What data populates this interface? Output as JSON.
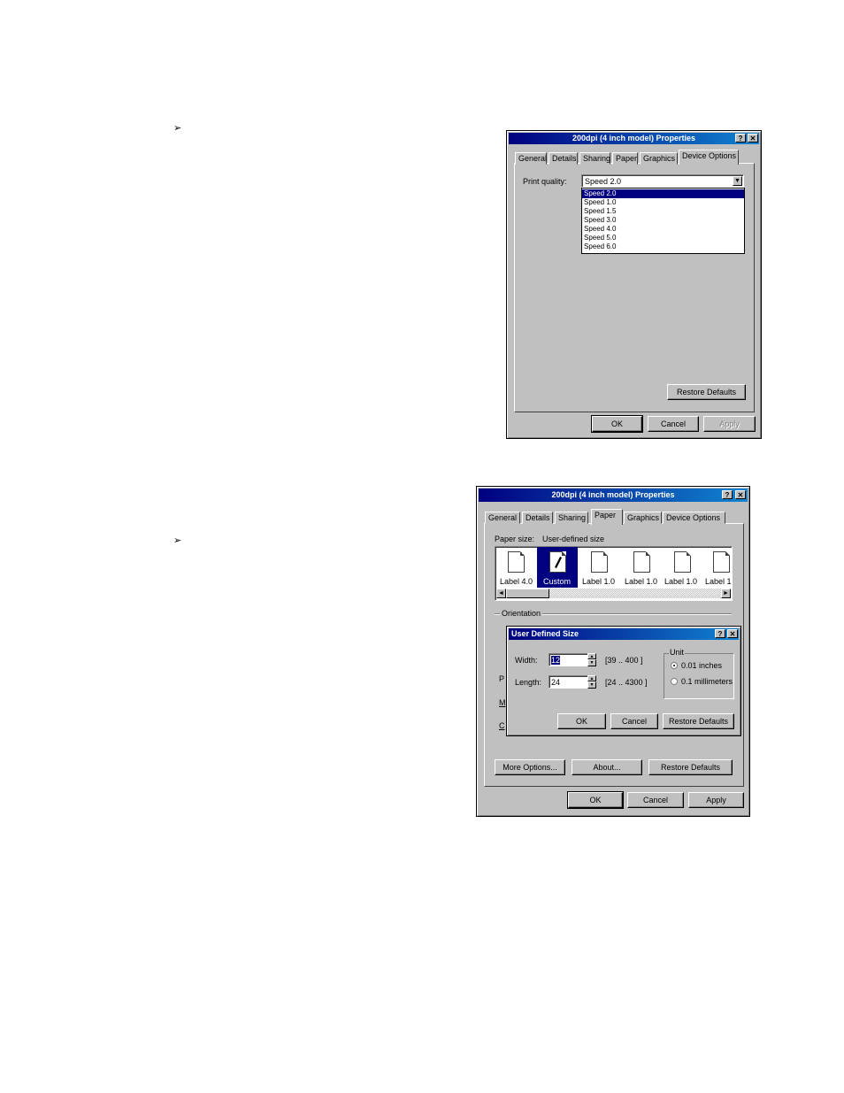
{
  "bullets": [
    "➢",
    "➢"
  ],
  "dialog1": {
    "title": "200dpi (4 inch model)  Properties",
    "help": "?",
    "close": "✕",
    "tabs": [
      "General",
      "Details",
      "Sharing",
      "Paper",
      "Graphics",
      "Device Options"
    ],
    "selected_tab": "Device Options",
    "print_quality_label": "Print quality:",
    "print_quality_value": "Speed 2.0",
    "dropdown_arrow": "▼",
    "options": [
      "Speed 2.0",
      "Speed 1.0",
      "Speed 1.5",
      "Speed 3.0",
      "Speed 4.0",
      "Speed 5.0",
      "Speed 6.0"
    ],
    "restore_defaults": "Restore Defaults",
    "ok": "OK",
    "cancel": "Cancel",
    "apply": "Apply"
  },
  "dialog2": {
    "title": "200dpi (4 inch model)  Properties",
    "help": "?",
    "close": "✕",
    "tabs": [
      "General",
      "Details",
      "Sharing",
      "Paper",
      "Graphics",
      "Device Options"
    ],
    "selected_tab": "Paper",
    "paper_size_label": "Paper size:",
    "paper_size_value": "User-defined size",
    "papers": [
      "Label 4.0",
      "Custom",
      "Label 1.0",
      "Label 1.0",
      "Label 1.0",
      "Label 1"
    ],
    "scroll_left": "◄",
    "scroll_right": "►",
    "orientation_label": "Orientation",
    "hidden_letters": [
      "P",
      "M",
      "C"
    ],
    "more_options": "More Options...",
    "about": "About...",
    "restore_defaults": "Restore Defaults",
    "ok": "OK",
    "cancel": "Cancel",
    "apply": "Apply"
  },
  "user_defined": {
    "title": "User Defined Size",
    "help": "?",
    "close": "✕",
    "width_label": "Width:",
    "width_value": "12",
    "width_range": "[39  .. 400  ]",
    "length_label": "Length:",
    "length_value": "24",
    "length_range": "[24  .. 4300  ]",
    "unit_label": "Unit",
    "unit_inches": "0.01 inches",
    "unit_mm": "0.1 millimeters",
    "spin_up": "▲",
    "spin_down": "▼",
    "ok": "OK",
    "cancel": "Cancel",
    "restore_defaults": "Restore Defaults"
  }
}
